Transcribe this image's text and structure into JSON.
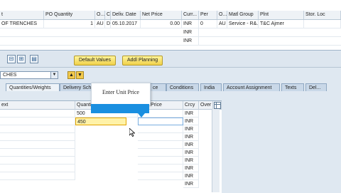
{
  "top_grid": {
    "headers": [
      "t",
      "PO Quantity",
      "O...",
      "C",
      "Deliv. Date",
      "Net Price",
      "Curr...",
      "Per",
      "O...",
      "Matl Group",
      "Plnt",
      "Stor. Loc"
    ],
    "row1": [
      "OF TRENCHES",
      "1",
      "AU",
      "D",
      "05.10.2017",
      "0.00",
      "INR",
      "0",
      "AU",
      "Service - R&...",
      "T&C Ajmer",
      ""
    ],
    "row2_curr": "INR",
    "row3_curr": "INR"
  },
  "toolbar": {
    "icon1": "⊟",
    "icon2": "⊞",
    "icon3": "▤",
    "default_values": "Default Values",
    "addl_planning": "Addl Planning"
  },
  "selector": {
    "value": "CHES",
    "dropdown": "▼",
    "up": "▲",
    "down": "▼"
  },
  "tabs": [
    "Quantities/Weights",
    "Delivery Sche",
    "ce",
    "Conditions",
    "India",
    "Account Assignment",
    "Texts",
    "Del..."
  ],
  "lower_grid": {
    "headers": [
      "ext",
      "Quanti",
      "Price",
      "Crcy",
      "Over"
    ],
    "row1_qty": "500",
    "row2_qty": "450",
    "crcy": [
      "INR",
      "INR",
      "INR",
      "INR",
      "INR",
      "INR",
      "INR",
      "INR",
      "INR",
      "INR"
    ]
  },
  "tooltip": {
    "text": "Enter Unit Price"
  },
  "colors": {
    "tooltip_bar": "#1a8fe0",
    "highlight_input": "#fff2a8",
    "button_yellow": "#f0d04a"
  }
}
